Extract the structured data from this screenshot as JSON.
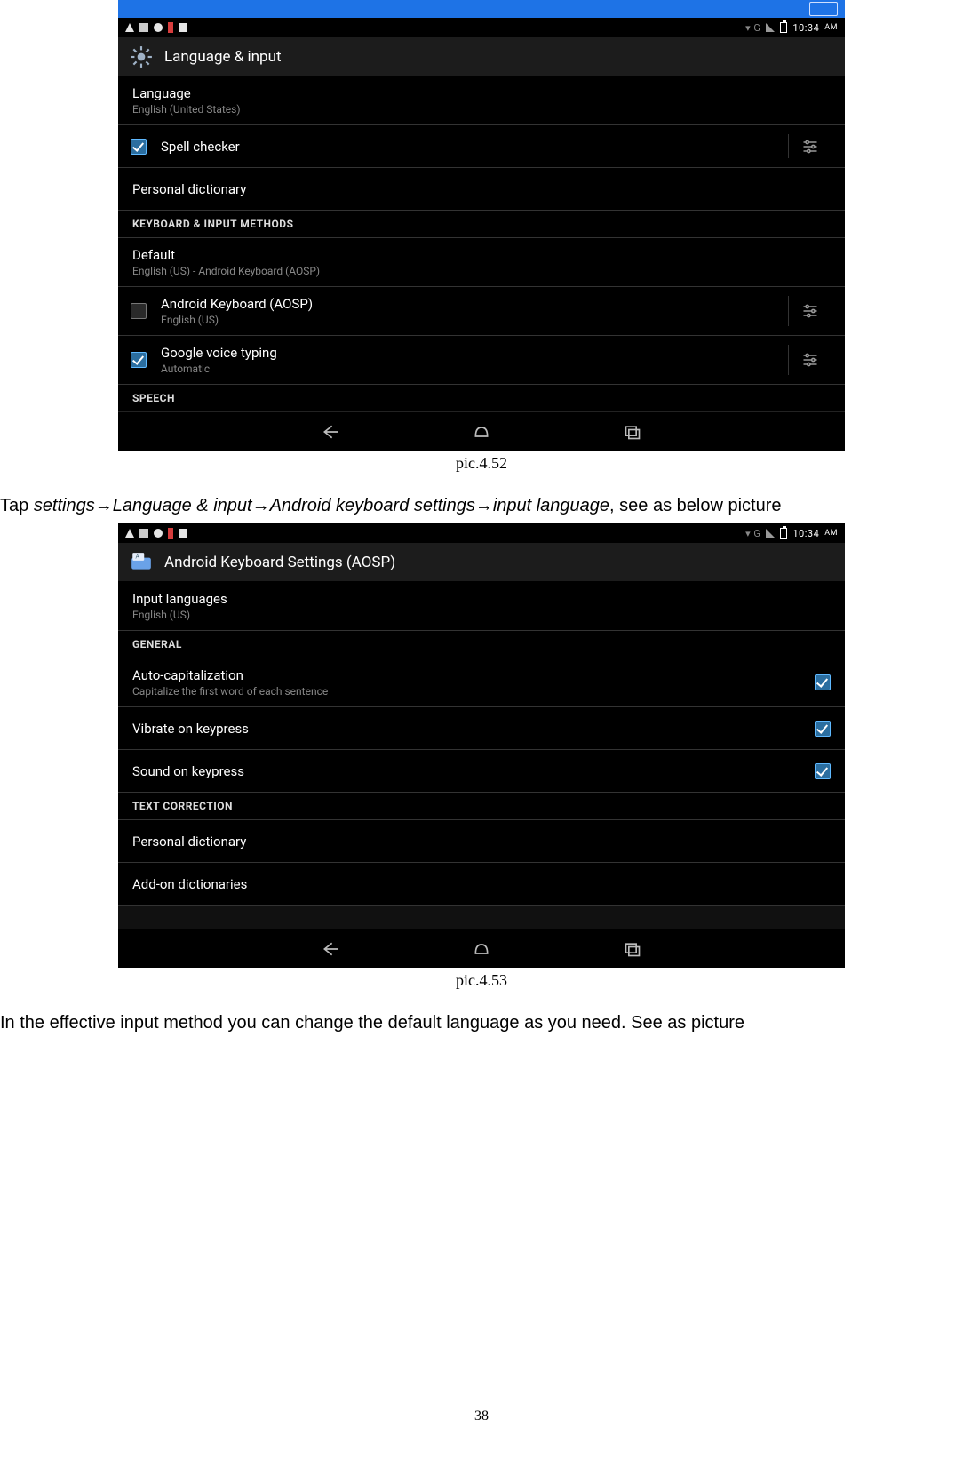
{
  "shot1": {
    "statusbar_time": "10:34",
    "statusbar_ampm": "AM",
    "header_title": "Language & input",
    "rows": {
      "language_title": "Language",
      "language_sub": "English (United States)",
      "spell_title": "Spell checker",
      "pdict_title": "Personal dictionary",
      "cat_kb": "KEYBOARD & INPUT METHODS",
      "default_title": "Default",
      "default_sub": "English (US) - Android Keyboard (AOSP)",
      "akb_title": "Android Keyboard (AOSP)",
      "akb_sub": "English (US)",
      "gvoice_title": "Google voice typing",
      "gvoice_sub": "Automatic",
      "cat_speech": "SPEECH"
    }
  },
  "caption1": "pic.4.52",
  "para1_pre": "Tap  ",
  "para1_path_a": "settings",
  "para1_path_b": "Language & input",
  "para1_path_c": "Android keyboard settings",
  "para1_path_d": "input language",
  "para1_post": ",  see  as  below picture",
  "shot2": {
    "statusbar_time": "10:34",
    "statusbar_ampm": "AM",
    "header_title": "Android Keyboard Settings (AOSP)",
    "rows": {
      "inputlang_title": "Input languages",
      "inputlang_sub": "English (US)",
      "cat_general": "GENERAL",
      "autocap_title": "Auto-capitalization",
      "autocap_sub": "Capitalize the first word of each sentence",
      "vibrate_title": "Vibrate on keypress",
      "sound_title": "Sound on keypress",
      "cat_text": "TEXT CORRECTION",
      "pdict_title": "Personal dictionary",
      "addon_title": "Add-on dictionaries"
    }
  },
  "caption2": "pic.4.53",
  "para2": "In the effective input method you can change the default language as you need. See as picture",
  "page_number": "38"
}
